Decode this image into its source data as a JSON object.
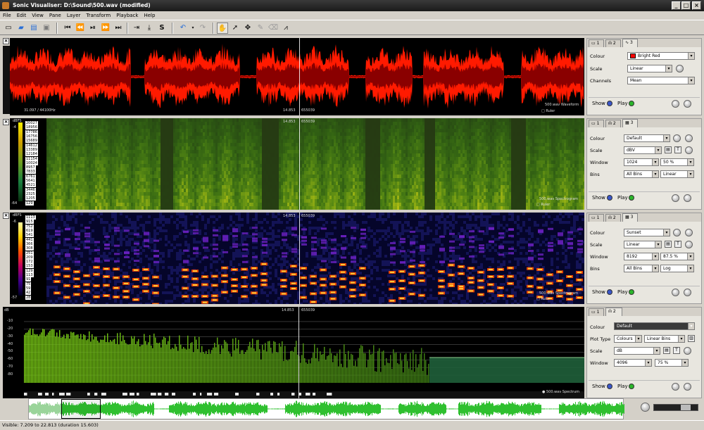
{
  "window": {
    "title": "Sonic Visualiser: D:\\Sound\\500.wav (modified)",
    "minimize": "_",
    "maximize": "□",
    "close": "×"
  },
  "menu": [
    "File",
    "Edit",
    "View",
    "Pane",
    "Layer",
    "Transform",
    "Playback",
    "Help"
  ],
  "panes": [
    {
      "name": "waveform",
      "time_left": "31.097 / 44100Hz",
      "time_cursor": "14.853",
      "frame": "655039",
      "layer": "500.wav Waveform",
      "ruler": "Ruler",
      "tabs": [
        "1",
        "2",
        "3"
      ],
      "props": {
        "colour_label": "Colour",
        "colour": "Bright Red",
        "scale_label": "Scale",
        "scale": "Linear",
        "channels_label": "Channels",
        "channels": "Mean"
      },
      "show": "Show",
      "play": "Play"
    },
    {
      "name": "spectrogram-1",
      "unit": "dBFS",
      "top": "-4",
      "bottom": "-64",
      "freqs": [
        "20027",
        "18956",
        "17786",
        "16756",
        "15689",
        "14612",
        "13389",
        "12184",
        "11154",
        "10024",
        "8957",
        "7833",
        "6761",
        "5641",
        "4521",
        "3446",
        "2325",
        "1205",
        "129"
      ],
      "time_cursor": "14.853",
      "frame": "655039",
      "layer": "500.wav Spectrogram",
      "ruler": "Ruler",
      "tabs": [
        "1",
        "2",
        "3"
      ],
      "props": {
        "colour_label": "Colour",
        "colour": "Default",
        "scale_label": "Scale",
        "scale": "dBV",
        "window_label": "Window",
        "window": "1024",
        "overlap": "50 %",
        "bins_label": "Bins",
        "bins": "All Bins",
        "binscale": "Linear"
      },
      "show": "Show",
      "play": "Play"
    },
    {
      "name": "spectrogram-2",
      "unit": "dBFS",
      "top": "-6",
      "bottom": "-57",
      "freqs": [
        "1113",
        "915",
        "752",
        "619",
        "541",
        "441",
        "366",
        "308",
        "251",
        "209",
        "172",
        "153",
        "129",
        "113",
        "91",
        "75",
        "59",
        "42",
        "28"
      ],
      "time_cursor": "14.853",
      "frame": "655039",
      "layer": "500.wav Spectrogram",
      "ruler": "Ruler",
      "tabs": [
        "1",
        "2",
        "3"
      ],
      "props": {
        "colour_label": "Colour",
        "colour": "Sunset",
        "scale_label": "Scale",
        "scale": "Linear",
        "window_label": "Window",
        "window": "8192",
        "overlap": "87.5 %",
        "bins_label": "Bins",
        "bins": "All Bins",
        "binscale": "Log"
      },
      "show": "Show",
      "play": "Play"
    },
    {
      "name": "spectrum",
      "unit": "dB",
      "db_ticks": [
        "-10",
        "-20",
        "-30",
        "-40",
        "-50",
        "-60",
        "-70",
        "-80"
      ],
      "time_cursor": "14.853",
      "frame": "655039",
      "layer": "500.wav Spectrum",
      "tabs": [
        "1",
        "2"
      ],
      "props": {
        "colour_label": "Colour",
        "colour": "Default",
        "plottype_label": "Plot Type",
        "plottype": "Colours",
        "binmode": "Linear Bins",
        "scale_label": "Scale",
        "scale": "dB",
        "window_label": "Window",
        "window": "4096",
        "overlap": "75 %"
      },
      "show": "Show",
      "play": "Play"
    }
  ],
  "status": "Visible: 7.209 to 22.813 (duration 15.603)",
  "colors": {
    "waveform": "#ff1a00",
    "spectrum": "#7cbd1e",
    "overview": "#2fc02f"
  }
}
